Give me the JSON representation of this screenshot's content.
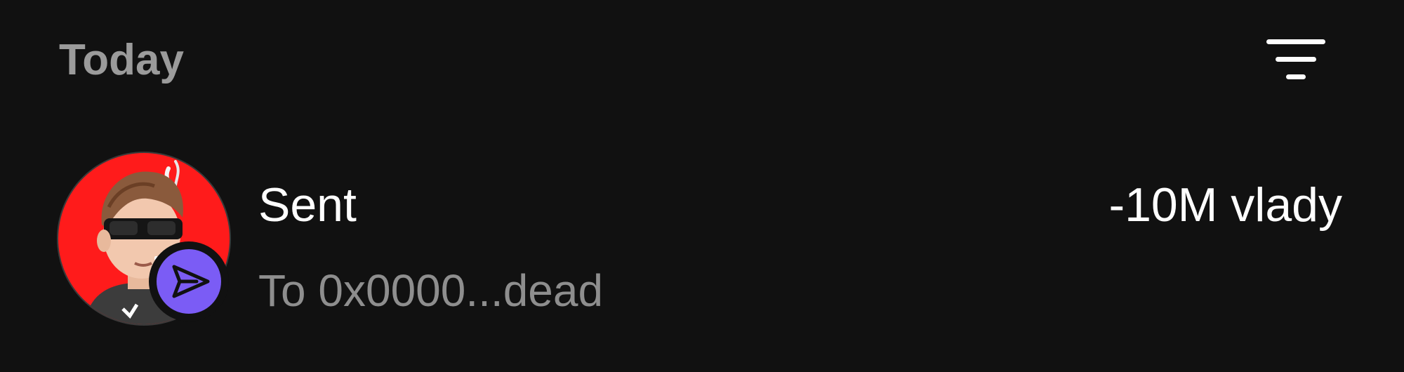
{
  "header": {
    "section_title": "Today",
    "filter_icon": "filter-lines-icon"
  },
  "transactions": [
    {
      "title": "Sent",
      "subtitle": "To 0x0000...dead",
      "amount": "-10M vlady",
      "avatar_icon": "user-avatar",
      "badge_icon": "send-arrow-icon",
      "badge_color": "#7b5cf5",
      "avatar_bg_color": "#ff1b1b"
    }
  ],
  "colors": {
    "background": "#111111",
    "section_title": "#9b9b9b",
    "primary_text": "#ffffff",
    "secondary_text": "#8e8e8e"
  }
}
